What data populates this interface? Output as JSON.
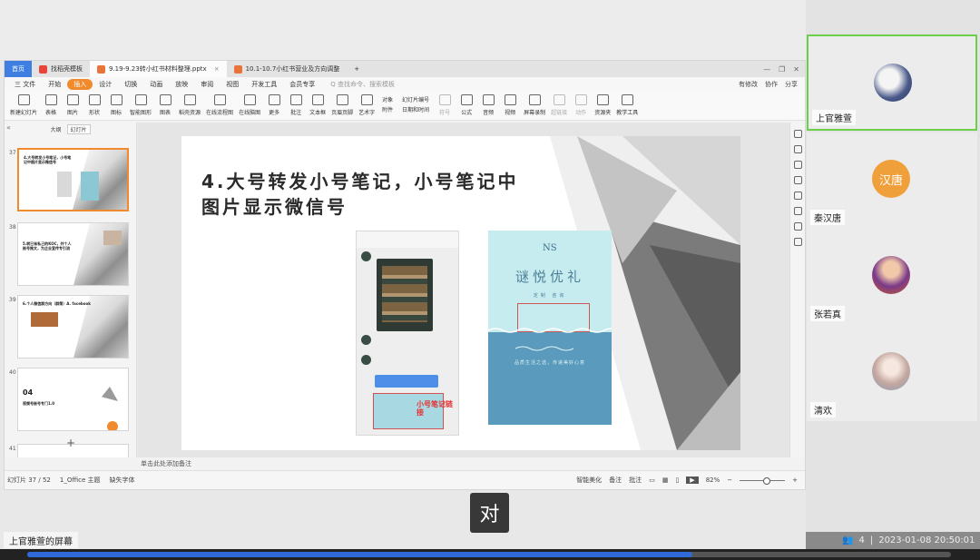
{
  "wps": {
    "tabs": [
      {
        "label": "首页"
      },
      {
        "label": "找稻壳模板"
      },
      {
        "label": "9.19-9.23转小红书材料整理.pptx"
      },
      {
        "label": "10.1-10.7小红书营业及方向调整"
      }
    ],
    "new_tab": "+",
    "menus": [
      "三 文件",
      "开始",
      "插入",
      "设计",
      "切换",
      "动画",
      "放映",
      "审阅",
      "视图",
      "开发工具",
      "会员专享"
    ],
    "search_placeholder": "Q 查找命令、搜索模板",
    "menu_right": [
      "有修改",
      "协作",
      "分享"
    ],
    "ribbon": [
      "新建幻灯片",
      "表格",
      "图片",
      "形状",
      "图标",
      "智能图形",
      "图表",
      "稻壳资源",
      "在线流程图",
      "在线脑图",
      "更多",
      "批注",
      "文本框",
      "页眉页脚",
      "艺术字"
    ],
    "ribbon_small": [
      "对象",
      "附件",
      "幻灯片编号",
      "日期和时间"
    ],
    "ribbon_right": [
      "符号",
      "公式",
      "音频",
      "视频",
      "屏幕录制",
      "超链接",
      "动作",
      "资源夹",
      "教学工具"
    ],
    "thumb_tabs": [
      "大纲",
      "幻灯片"
    ],
    "slides": [
      {
        "num": "37",
        "text": "4.大号转发小号笔记，小号笔记中图片显示微信号"
      },
      {
        "num": "38",
        "text": "5.转已有私己的KOC，并个人账号推文，为企业宣传专引流"
      },
      {
        "num": "39",
        "text": "6.个人微信群方向（群策）A. facebook"
      },
      {
        "num": "40",
        "text": "04",
        "sub": "视频号账号专门1.0"
      },
      {
        "num": "41",
        "text": ""
      }
    ],
    "add_slide": "+",
    "slide_title": "4.大号转发小号笔记，小号笔记中图片显示微信号",
    "phone_label": "小号笔记链接",
    "poster_logo": "NS",
    "poster_title": "谜悦优礼",
    "poster_sub": "定制 咨询",
    "poster_foot": "品质生活之选，传递美好心意",
    "notes_placeholder": "单击此处添加备注",
    "status_left": [
      "幻灯片 37 / 52",
      "1_Office 主题",
      "缺失字体"
    ],
    "status_right": [
      "智能美化",
      "备注",
      "批注"
    ],
    "zoom": "82%"
  },
  "subtitle": "对",
  "screen_label": "上官雅萱的屏幕",
  "participants": [
    {
      "name": "上官雅萱",
      "active": true
    },
    {
      "name": "秦汉唐",
      "avatar_text": "汉唐"
    },
    {
      "name": "张若真"
    },
    {
      "name": "清欢"
    }
  ],
  "footer": {
    "count": "4",
    "sep": "|",
    "datetime": "2023-01-08 20:50:01"
  },
  "progress_fraction": 0.72,
  "colors": {
    "accent_orange": "#f08a2c",
    "home_blue": "#3f7fe2",
    "active_green": "#6bcf4a",
    "progress_blue": "#2f6bd8"
  }
}
